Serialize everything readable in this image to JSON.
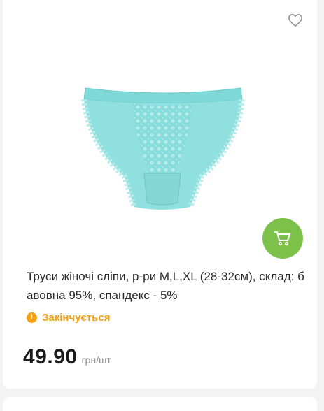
{
  "product": {
    "title": "Труси жіночі сліпи, р-ри M,L,XL (28-32см), склад: бавовна 95%, спандекс - 5%",
    "status": "Закінчується",
    "price": "49.90",
    "unit": "грн/шт",
    "image_alt": "product-photo-panties"
  },
  "icons": {
    "favorite": "heart-outline-icon",
    "cart": "shopping-cart-icon",
    "status": "warning-circle-icon"
  },
  "colors": {
    "accent": "#7cc24a",
    "warning": "#f4a116",
    "product": "#8fe0df"
  }
}
